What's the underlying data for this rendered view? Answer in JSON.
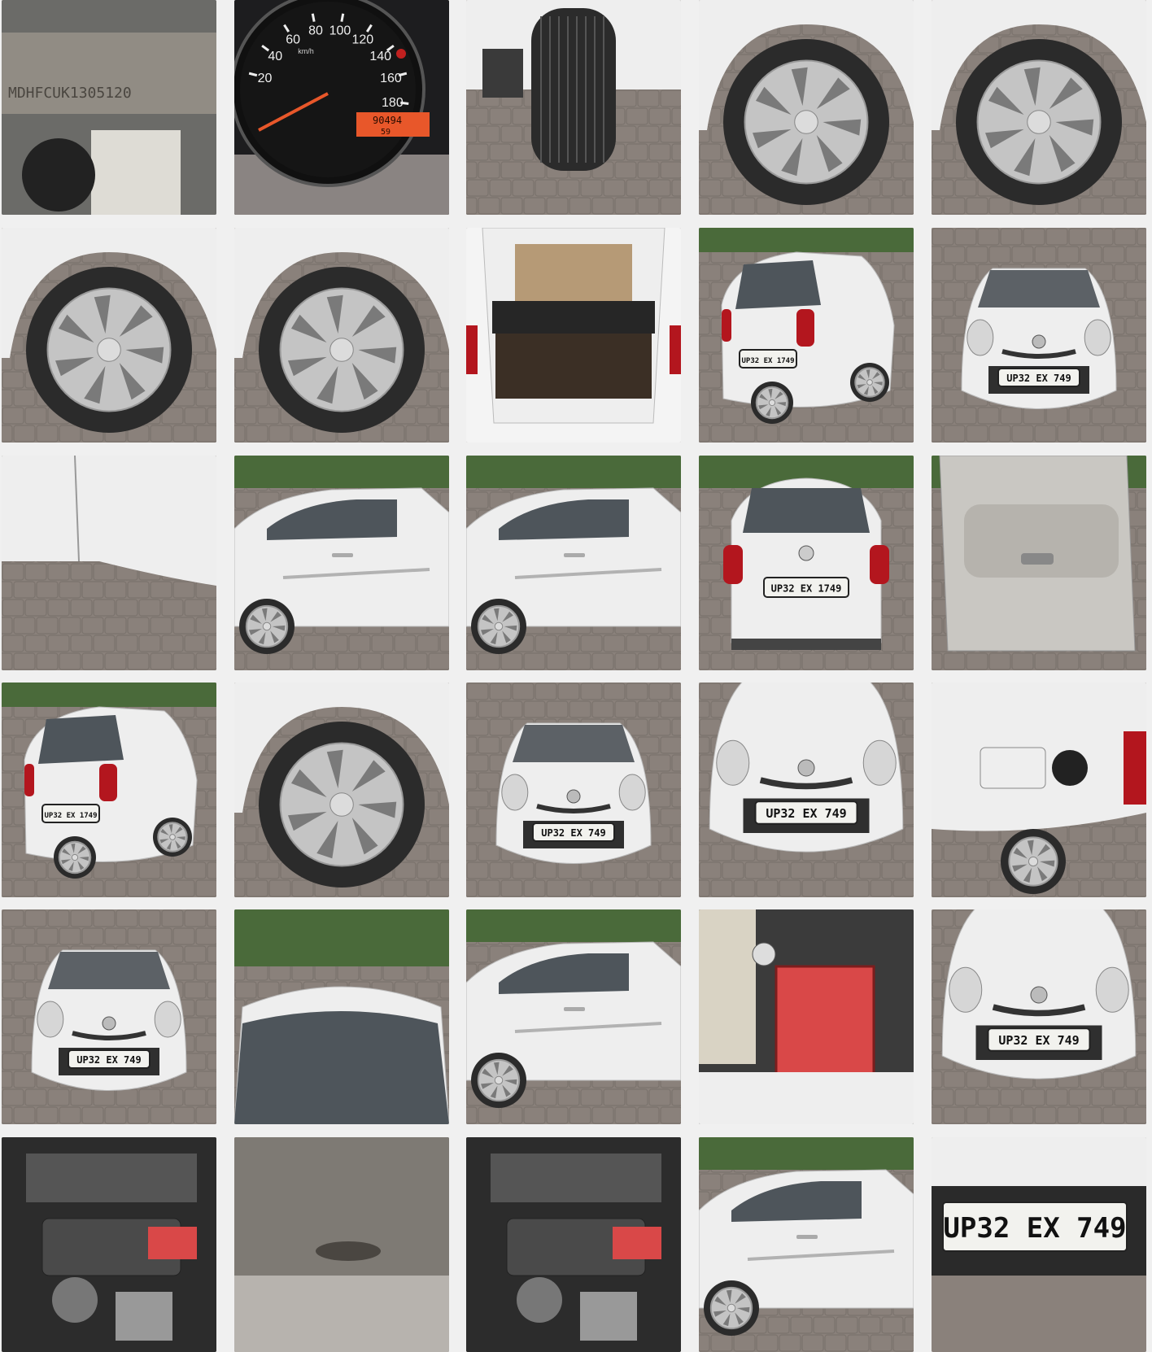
{
  "gallery": {
    "tiles": [
      {
        "kind": "chassis",
        "text": "MDHFCUK1305120"
      },
      {
        "kind": "speedometer",
        "ticks": [
          "20",
          "40",
          "60",
          "80",
          "100",
          "120",
          "140",
          "160",
          "180"
        ],
        "unit": "km/h",
        "odometer": "90494",
        "trip": "59"
      },
      {
        "kind": "tyre-front"
      },
      {
        "kind": "wheel"
      },
      {
        "kind": "wheel"
      },
      {
        "kind": "wheel"
      },
      {
        "kind": "wheel"
      },
      {
        "kind": "boot"
      },
      {
        "kind": "car-rear-angle",
        "plate": "UP32 EX 1749"
      },
      {
        "kind": "car-front",
        "plate": "UP32 EX 749"
      },
      {
        "kind": "body-panel"
      },
      {
        "kind": "car-side"
      },
      {
        "kind": "car-side"
      },
      {
        "kind": "car-rear",
        "plate": "UP32 EX 1749"
      },
      {
        "kind": "door-interior"
      },
      {
        "kind": "car-rear-angle",
        "plate": "UP32 EX 1749"
      },
      {
        "kind": "wheel"
      },
      {
        "kind": "car-front",
        "plate": "UP32 EX 749"
      },
      {
        "kind": "car-front-close",
        "plate": "UP32 EX 749"
      },
      {
        "kind": "fuel-lid"
      },
      {
        "kind": "car-front",
        "plate": "UP32 EX 749"
      },
      {
        "kind": "roof"
      },
      {
        "kind": "car-side"
      },
      {
        "kind": "battery"
      },
      {
        "kind": "car-front-close",
        "plate": "UP32 EX 749"
      },
      {
        "kind": "engine"
      },
      {
        "kind": "underbody"
      },
      {
        "kind": "engine"
      },
      {
        "kind": "car-side"
      },
      {
        "kind": "plate-close",
        "plate": "UP32 EX 749"
      }
    ]
  },
  "colors": {
    "paving": "#8a817b",
    "car": "#eeeeee",
    "tyre": "#2b2b2b",
    "hubcap": "#c4c4c4",
    "plate": "#f2f2ee",
    "battery": "#d94848",
    "foliage": "#4a6a3a",
    "display": "#e8572a"
  }
}
